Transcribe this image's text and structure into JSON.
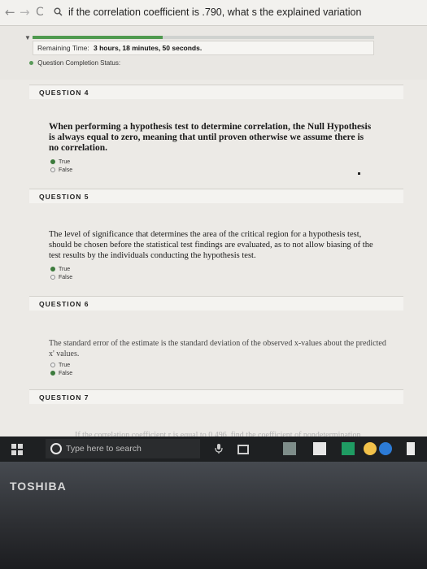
{
  "browser": {
    "back": "←",
    "forward": "→",
    "reload": "C",
    "address": "if the correlation coefficient is .790, what s the explained variation"
  },
  "timer": {
    "label": "Remaining Time:",
    "value": "3 hours, 18 minutes, 50 seconds.",
    "progress_fraction": 0.38
  },
  "status": {
    "label": "Question Completion Status:"
  },
  "questions": [
    {
      "header": "QUESTION 4",
      "text": "When performing a hypothesis test to determine correlation, the Null Hypothesis is always equal to zero, meaning that until proven otherwise we assume there is no correlation.",
      "options": [
        {
          "label": "True",
          "selected": true
        },
        {
          "label": "False",
          "selected": false
        }
      ]
    },
    {
      "header": "QUESTION 5",
      "text": "The level of significance that determines the area of the critical region for a hypothesis test, should be chosen before the statistical test findings are evaluated, as to not allow biasing of the test results by the individuals conducting the hypothesis test.",
      "options": [
        {
          "label": "True",
          "selected": true
        },
        {
          "label": "False",
          "selected": false
        }
      ]
    },
    {
      "header": "QUESTION 6",
      "text": "The standard error of the estimate is the standard deviation of the observed x-values about the predicted x' values.",
      "options": [
        {
          "label": "True",
          "selected": false
        },
        {
          "label": "False",
          "selected": true
        }
      ]
    },
    {
      "header": "QUESTION 7",
      "text": "If the correlation coefficient r is equal to 0.496, find the coefficient of nondetermination"
    }
  ],
  "taskbar": {
    "search_placeholder": "Type here to search"
  },
  "laptop": {
    "brand": "TOSHIBA"
  },
  "colors": {
    "selected_radio": "#3d7b3d",
    "progress": "#4f9a4f",
    "taskbar": "#1e2022"
  }
}
